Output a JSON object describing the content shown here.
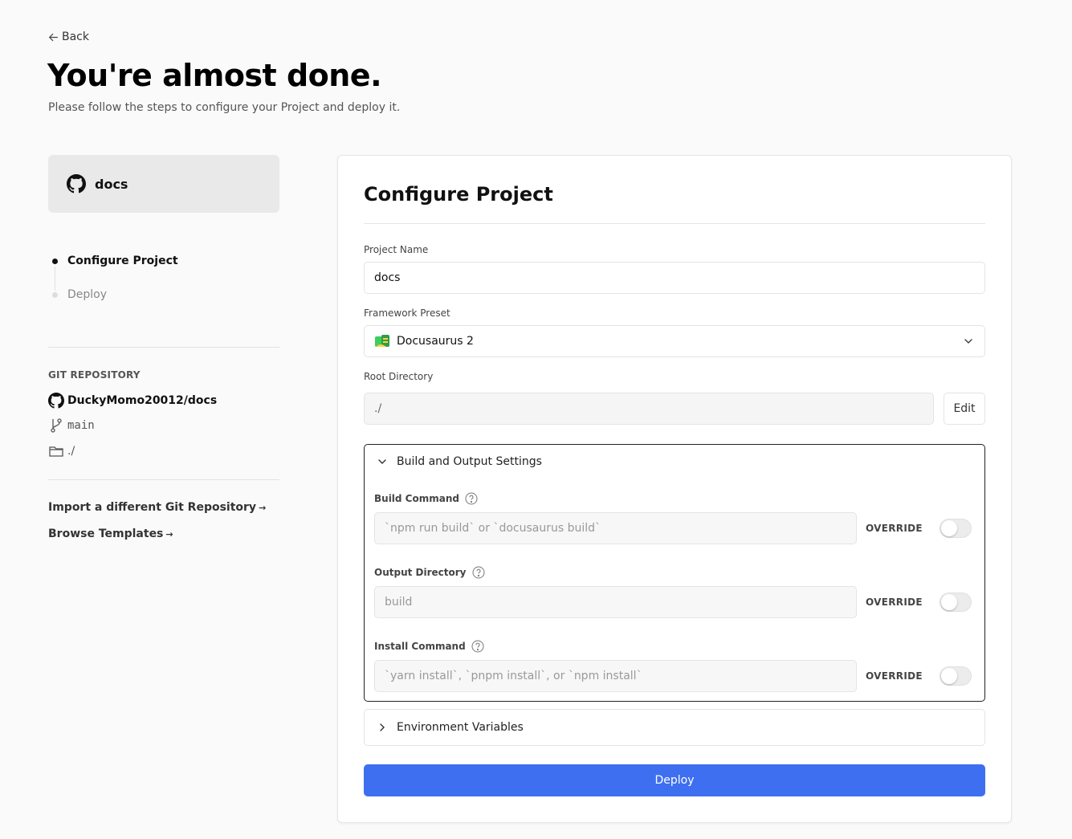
{
  "header": {
    "back_label": "Back",
    "title": "You're almost done.",
    "subtitle": "Please follow the steps to configure your Project and deploy it."
  },
  "sidebar": {
    "repo_card_name": "docs",
    "steps": [
      {
        "label": "Configure Project",
        "active": true
      },
      {
        "label": "Deploy",
        "active": false
      }
    ],
    "git_heading": "GIT REPOSITORY",
    "repo_full_name": "DuckyMomo20012/docs",
    "branch": "main",
    "directory": "./",
    "links": [
      {
        "label": "Import a different Git Repository",
        "arrow": "→"
      },
      {
        "label": "Browse Templates",
        "arrow": "→"
      }
    ]
  },
  "configure": {
    "title": "Configure Project",
    "project_name_label": "Project Name",
    "project_name_value": "docs",
    "framework_label": "Framework Preset",
    "framework_value": "Docusaurus 2",
    "root_dir_label": "Root Directory",
    "root_dir_value": "./",
    "edit_label": "Edit",
    "build_section_label": "Build and Output Settings",
    "override_label": "OVERRIDE",
    "build_fields": [
      {
        "label": "Build Command",
        "placeholder": "`npm run build` or `docusaurus build`",
        "override": false
      },
      {
        "label": "Output Directory",
        "placeholder": "build",
        "override": false
      },
      {
        "label": "Install Command",
        "placeholder": "`yarn install`, `pnpm install`, or `npm install`",
        "override": false
      }
    ],
    "env_section_label": "Environment Variables",
    "deploy_label": "Deploy"
  },
  "colors": {
    "accent": "#3d6ff0",
    "background": "#fafafa"
  }
}
